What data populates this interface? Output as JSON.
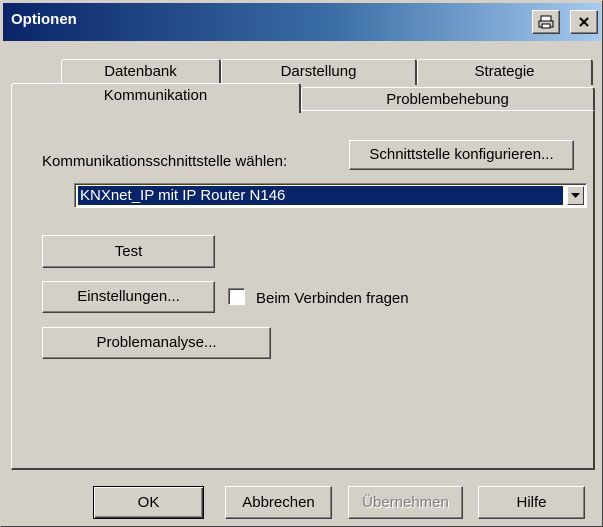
{
  "window": {
    "title": "Optionen"
  },
  "titlebar": {
    "icons": [
      "print-icon",
      "close-icon"
    ]
  },
  "tabs": {
    "row_back": [
      "Datenbank",
      "Darstellung",
      "Strategie"
    ],
    "row_front": [
      "Kommunikation",
      "Problembehebung"
    ],
    "active": "Kommunikation"
  },
  "panel": {
    "interface_label": "Kommunikationsschnittstelle wählen:",
    "configure_button": "Schnittstelle konfigurieren...",
    "interface_select": {
      "selected": "KNXnet_IP mit IP Router N146"
    },
    "test_button": "Test",
    "settings_button": "Einstellungen...",
    "ask_on_connect": {
      "label": "Beim Verbinden fragen",
      "checked": false
    },
    "analysis_button": "Problemanalyse..."
  },
  "footer": {
    "ok": "OK",
    "cancel": "Abbrechen",
    "apply": "Übernehmen",
    "help": "Hilfe"
  }
}
